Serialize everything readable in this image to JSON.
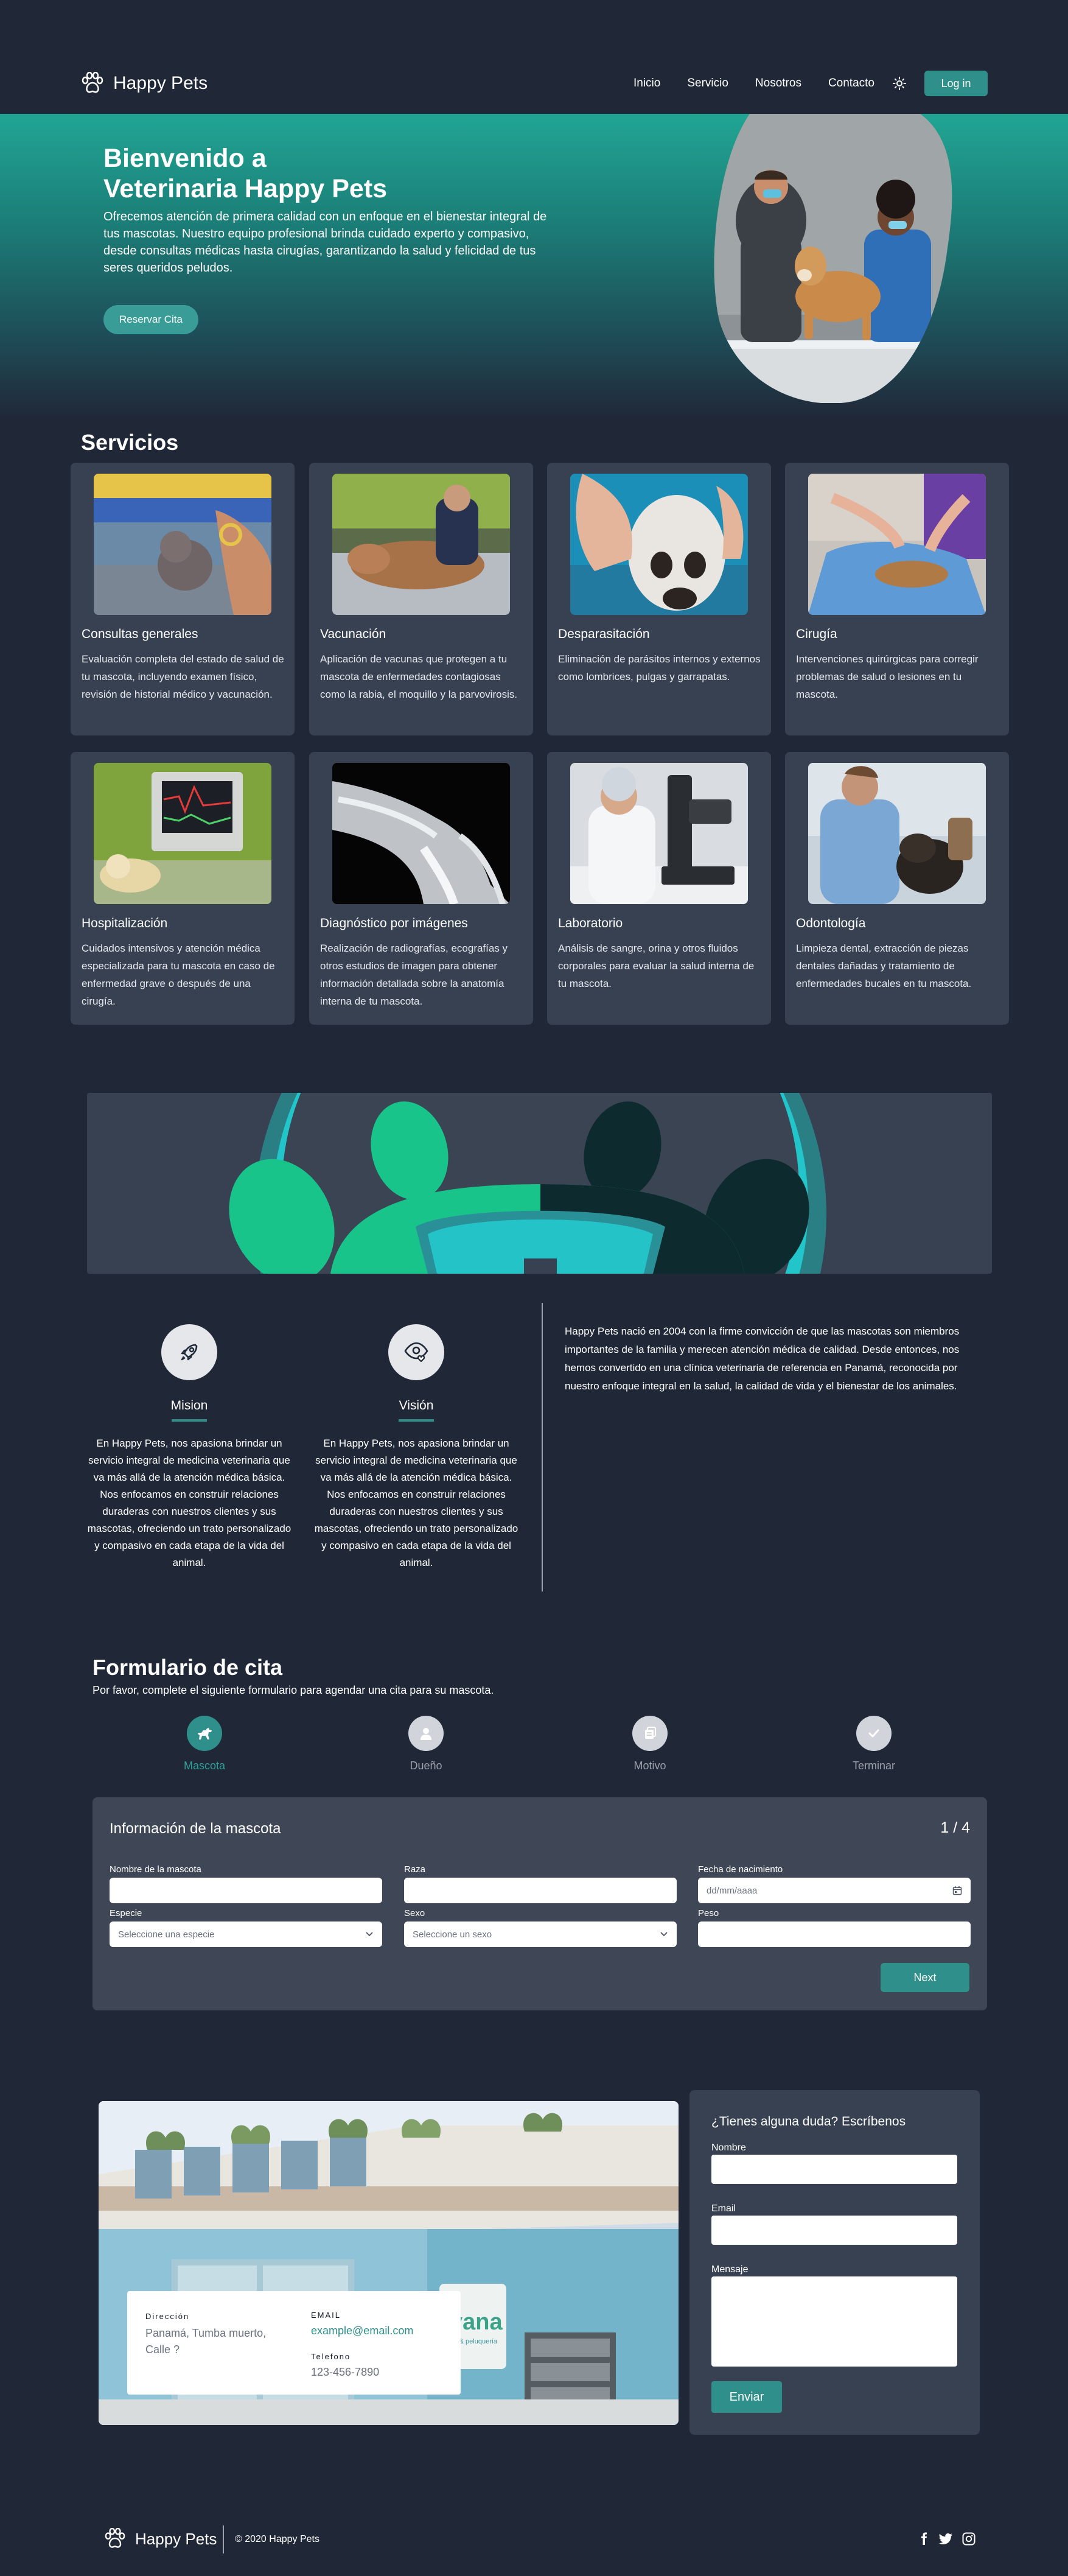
{
  "nav": {
    "brand": "Happy Pets",
    "links": [
      "Inicio",
      "Servicio",
      "Nosotros",
      "Contacto"
    ],
    "login": "Log in"
  },
  "hero": {
    "title_line1": "Bienvenido a",
    "title_line2": "Veterinaria Happy Pets",
    "text": "Ofrecemos atención de primera calidad con un enfoque en el bienestar integral de tus mascotas. Nuestro equipo profesional brinda cuidado experto y compasivo, desde consultas médicas hasta cirugías, garantizando la salud y felicidad de tus seres queridos peludos.",
    "button": "Reservar Cita"
  },
  "services": {
    "title": "Servicios",
    "items": [
      {
        "title": "Consultas generales",
        "desc": "Evaluación completa del estado de salud de tu mascota, incluyendo examen físico, revisión de historial médico y vacunación."
      },
      {
        "title": "Vacunación",
        "desc": "Aplicación de vacunas que protegen a tu mascota de enfermedades contagiosas como la rabia, el moquillo y la parvovirosis."
      },
      {
        "title": "Desparasitación",
        "desc": "Eliminación de parásitos internos y externos como lombrices, pulgas y garrapatas."
      },
      {
        "title": "Cirugía",
        "desc": "Intervenciones quirúrgicas para corregir problemas de salud o lesiones en tu mascota."
      },
      {
        "title": "Hospitalización",
        "desc": "Cuidados intensivos y atención médica especializada para tu mascota en caso de enfermedad grave o después de una cirugía."
      },
      {
        "title": "Diagnóstico por imágenes",
        "desc": "Realización de radiografías, ecografías y otros estudios de imagen para obtener información detallada sobre la anatomía interna de tu mascota."
      },
      {
        "title": "Laboratorio",
        "desc": "Análisis de sangre, orina y otros fluidos corporales para evaluar la salud interna de tu mascota."
      },
      {
        "title": "Odontología",
        "desc": "Limpieza dental, extracción de piezas dentales dañadas y tratamiento de enfermedades bucales en tu mascota."
      }
    ]
  },
  "about": {
    "mission_title": "Mision",
    "mission_text": "En Happy Pets, nos apasiona brindar un servicio integral de medicina veterinaria que va más allá de la atención médica básica. Nos enfocamos en construir relaciones duraderas con nuestros clientes y sus mascotas, ofreciendo un trato personalizado y compasivo en cada etapa de la vida del animal.",
    "vision_title": "Visión",
    "vision_text": "En Happy Pets, nos apasiona brindar un servicio integral de medicina veterinaria que va más allá de la atención médica básica. Nos enfocamos en construir relaciones duraderas con nuestros clientes y sus mascotas, ofreciendo un trato personalizado y compasivo en cada etapa de la vida del animal.",
    "history": "Happy Pets nació en 2004 con la firme convicción de que las mascotas son miembros importantes de la familia y merecen atención médica de calidad. Desde entonces, nos hemos convertido en una clínica veterinaria de referencia en Panamá, reconocida por nuestro enfoque integral en la salud, la calidad de vida y el bienestar de los animales."
  },
  "form": {
    "title": "Formulario de cita",
    "subtitle": "Por favor, complete el siguiente formulario para agendar una cita para su mascota.",
    "steps": [
      "Mascota",
      "Dueño",
      "Motivo",
      "Terminar"
    ],
    "card_title": "Información de la mascota",
    "counter": "1 / 4",
    "labels": {
      "pet_name": "Nombre de la mascota",
      "breed": "Raza",
      "birth_date": "Fecha de nacimiento",
      "species": "Especie",
      "sex": "Sexo",
      "weight": "Peso"
    },
    "date_placeholder": "dd/mm/aaaa",
    "species_placeholder": "Seleccione una especie",
    "sex_placeholder": "Seleccione un sexo",
    "next": "Next"
  },
  "contact": {
    "address_label": "Dirección",
    "address": "Panamá, Tumba muerto, Calle ?",
    "email_label": "EMAIL",
    "email": "example@email.com",
    "phone_label": "Telefono",
    "phone": "123-456-7890",
    "sign_text": "Ivana",
    "sign_sub": "vet & peluquería",
    "form_title": "¿Tienes alguna duda? Escríbenos",
    "name_label": "Nombre",
    "email_field_label": "Email",
    "message_label": "Mensaje",
    "send": "Enviar"
  },
  "footer": {
    "brand": "Happy Pets",
    "copyright": "© 2020 Happy Pets"
  },
  "colors": {
    "background": "#202838",
    "card": "#374151",
    "accent": "#2e8f8b",
    "hero_top": "#21a593"
  }
}
